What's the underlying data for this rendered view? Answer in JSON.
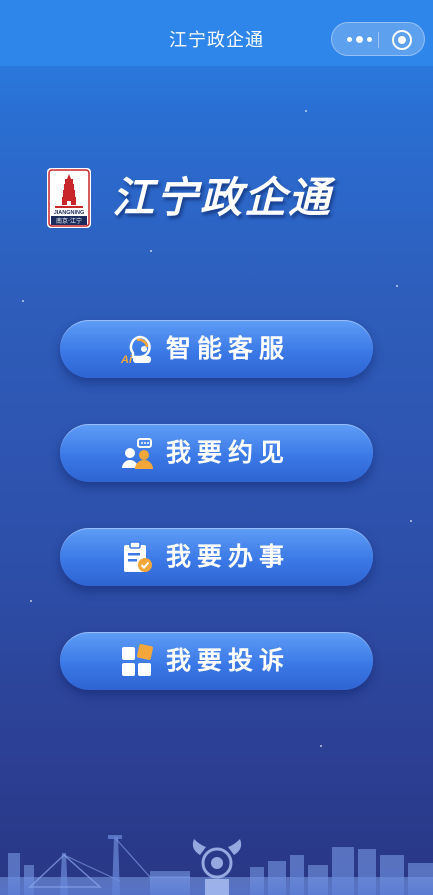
{
  "navbar": {
    "title": "江宁政企通",
    "more_icon": "more-dots-icon",
    "close_icon": "mini-program-close-icon"
  },
  "header": {
    "logo_icon": "jiangning-tower-logo",
    "logo_text_top": "JIANGNING",
    "logo_text_bottom": "南京·江宁",
    "app_name": "江宁政企通"
  },
  "menu": [
    {
      "label": "智能客服",
      "icon": "ai-service-icon"
    },
    {
      "label": "我要约见",
      "icon": "meeting-people-icon"
    },
    {
      "label": "我要办事",
      "icon": "clipboard-check-icon"
    },
    {
      "label": "我要投诉",
      "icon": "grid-blocks-icon"
    }
  ],
  "footer": {
    "skyline": "city-skyline-decoration"
  },
  "colors": {
    "navbar": "#2f86ea",
    "button_top": "#5f9df7",
    "button_bottom": "#2f64d2",
    "icon_orange": "#f3a73a",
    "logo_red": "#c8262b"
  }
}
